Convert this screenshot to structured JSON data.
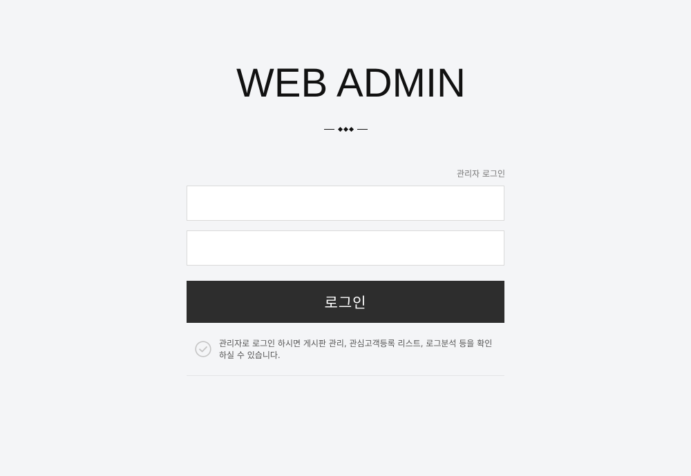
{
  "header": {
    "title": "WEB ADMIN"
  },
  "form": {
    "caption": "관리자 로그인",
    "id_field": {
      "value": "",
      "placeholder": ""
    },
    "password_field": {
      "value": "",
      "placeholder": ""
    },
    "login_label": "로그인"
  },
  "notice": {
    "icon": "check-circle-icon",
    "text": "관리자로 로그인 하시면 게시판 관리, 관심고객등록 리스트, 로그분석 등을 확인하실 수 있습니다."
  },
  "colors": {
    "background": "#f4f5f7",
    "button": "#2d2d2d",
    "button_text": "#ffffff",
    "title": "#111111"
  }
}
